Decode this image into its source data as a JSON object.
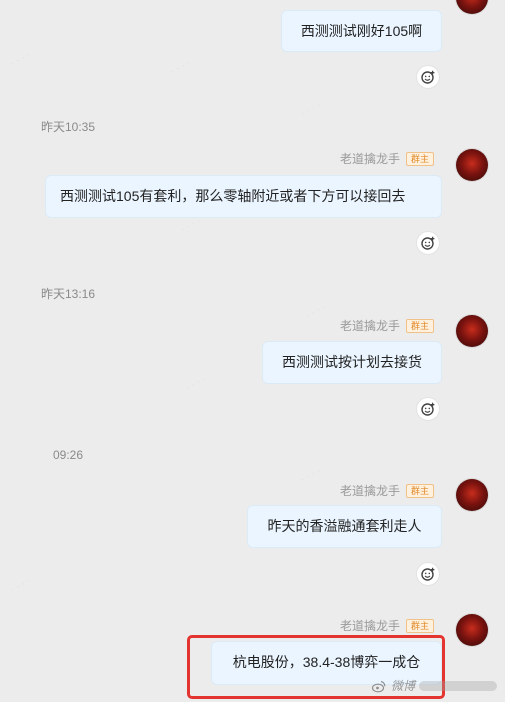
{
  "messages": [
    {
      "text": "西测测试刚好105啊"
    },
    {
      "timestamp": "昨天10:35",
      "sender": "老道擒龙手",
      "badge": "群主",
      "text": "西测测试105有套利，那么零轴附近或者下方可以接回去"
    },
    {
      "timestamp": "昨天13:16",
      "sender": "老道擒龙手",
      "badge": "群主",
      "text": "西测测试按计划去接货"
    },
    {
      "timestamp": "09:26",
      "sender": "老道擒龙手",
      "badge": "群主",
      "text": "昨天的香溢融通套利走人"
    },
    {
      "sender": "老道擒龙手",
      "badge": "群主",
      "text": "杭电股份，38.4-38博弈一成仓"
    }
  ],
  "watermark": {
    "platform": "微博",
    "icon": "weibo-icon"
  },
  "colors": {
    "background": "#ececec",
    "bubble": "#eaf5ff",
    "highlight": "#e3342f",
    "badge_text": "#e08a2b"
  }
}
